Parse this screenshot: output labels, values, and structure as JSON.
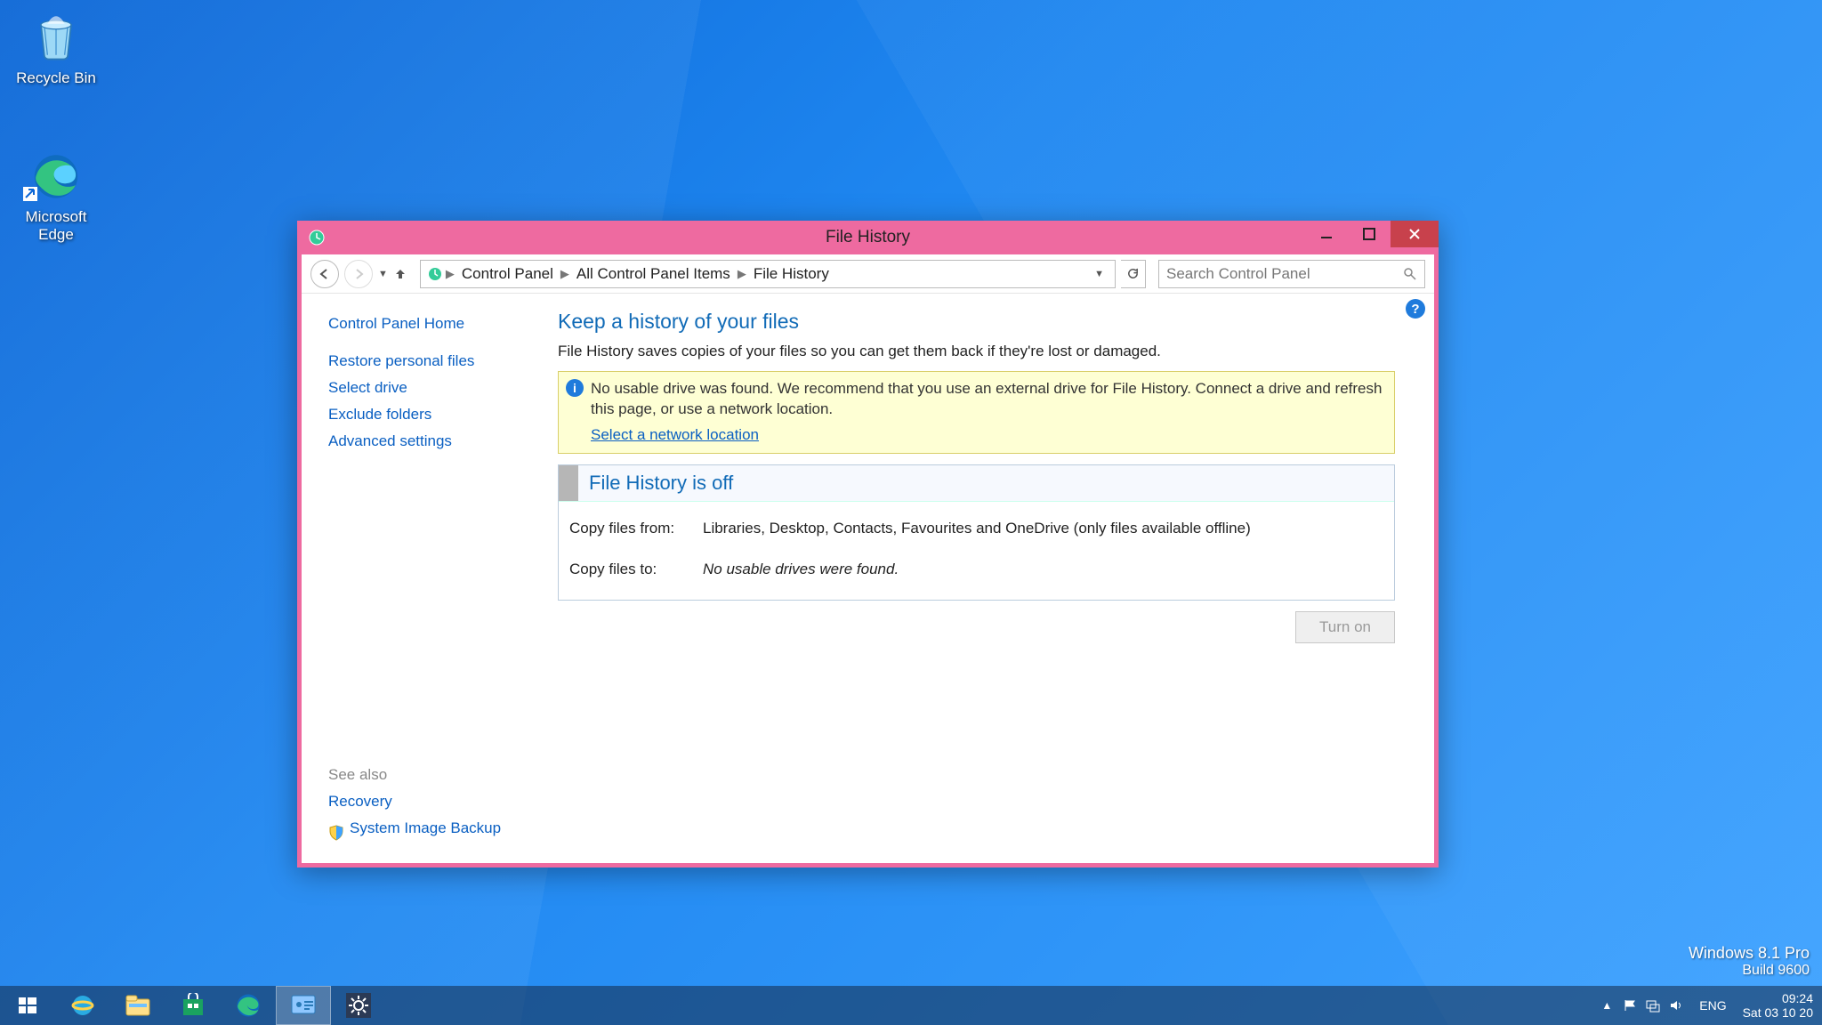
{
  "desktop": {
    "icons": [
      {
        "name": "recycle-bin",
        "label": "Recycle Bin"
      },
      {
        "name": "microsoft-edge",
        "label": "Microsoft Edge"
      }
    ]
  },
  "window": {
    "title": "File History",
    "breadcrumb": [
      "Control Panel",
      "All Control Panel Items",
      "File History"
    ],
    "search_placeholder": "Search Control Panel",
    "sidebar": {
      "home": "Control Panel Home",
      "links": [
        "Restore personal files",
        "Select drive",
        "Exclude folders",
        "Advanced settings"
      ],
      "see_also_label": "See also",
      "see_also": [
        "Recovery",
        "System Image Backup"
      ]
    },
    "main": {
      "heading": "Keep a history of your files",
      "description": "File History saves copies of your files so you can get them back if they're lost or damaged.",
      "notice_text": "No usable drive was found. We recommend that you use an external drive for File History. Connect a drive and refresh this page, or use a network location.",
      "notice_link": "Select a network location",
      "status_title": "File History is off",
      "copy_from_label": "Copy files from:",
      "copy_from_value": "Libraries, Desktop, Contacts, Favourites and OneDrive (only files available offline)",
      "copy_to_label": "Copy files to:",
      "copy_to_value": "No usable drives were found.",
      "turn_on": "Turn on"
    }
  },
  "watermark": {
    "line1": "Windows 8.1 Pro",
    "line2": "Build 9600"
  },
  "taskbar": {
    "lang": "ENG",
    "time": "09:24",
    "date": "Sat 03 10 20"
  }
}
